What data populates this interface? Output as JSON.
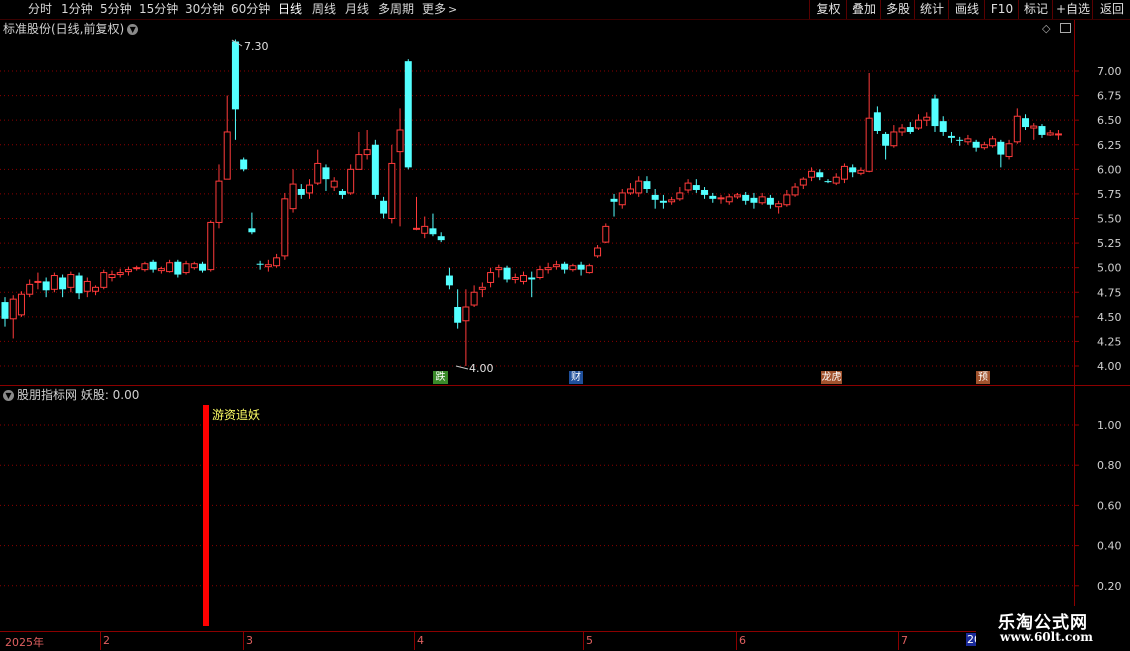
{
  "toolbar": {
    "periods": [
      "分时",
      "1分钟",
      "5分钟",
      "15分钟",
      "30分钟",
      "60分钟",
      "日线",
      "周线",
      "月线",
      "多周期",
      "更多"
    ],
    "active_period": "日线",
    "right_buttons": [
      "复权",
      "叠加",
      "多股",
      "统计",
      "画线",
      "F10",
      "标记",
      "+自选",
      "返回"
    ]
  },
  "main_panel": {
    "title": "标准股份(日线,前复权)",
    "price_axis": [
      "7.00",
      "6.75",
      "6.50",
      "6.25",
      "6.00",
      "5.75",
      "5.50",
      "5.25",
      "5.00",
      "4.75",
      "4.50",
      "4.25",
      "4.00"
    ],
    "high_label": "7.30",
    "low_label": "4.00",
    "event_badges": [
      {
        "text": "跌",
        "color": "#3a8a2a"
      },
      {
        "text": "财",
        "color": "#1f4f9a"
      },
      {
        "text": "龙虎",
        "color": "#a0522d"
      },
      {
        "text": "预",
        "color": "#a0522d"
      }
    ]
  },
  "indicator_panel": {
    "title": "股朋指标网 妖股: 0.00",
    "signal_label": "游资追妖",
    "axis": [
      "1.00",
      "0.80",
      "0.60",
      "0.40",
      "0.20"
    ]
  },
  "time_axis": [
    "2025年",
    "2",
    "3",
    "4",
    "5",
    "6",
    "7",
    "20"
  ],
  "watermark": {
    "line1": "乐淘公式网",
    "line2": "www.60lt.com"
  },
  "colors": {
    "up": "#ff3b3b",
    "down": "#54ffff",
    "grid": "#8b0000",
    "signal": "#ff0000",
    "label_yellow": "#ffff66"
  },
  "chart_data": {
    "type": "candlestick",
    "ylim": [
      3.9,
      7.25
    ],
    "candles": [
      [
        4.65,
        4.48,
        4.7,
        4.4
      ],
      [
        4.48,
        4.68,
        4.72,
        4.28
      ],
      [
        4.52,
        4.73,
        4.76,
        4.5
      ],
      [
        4.73,
        4.83,
        4.88,
        4.7
      ],
      [
        4.85,
        4.86,
        4.95,
        4.78
      ],
      [
        4.86,
        4.77,
        4.9,
        4.7
      ],
      [
        4.78,
        4.92,
        4.95,
        4.75
      ],
      [
        4.9,
        4.78,
        4.93,
        4.7
      ],
      [
        4.8,
        4.93,
        4.96,
        4.75
      ],
      [
        4.92,
        4.74,
        4.95,
        4.68
      ],
      [
        4.76,
        4.86,
        4.9,
        4.7
      ],
      [
        4.76,
        4.8,
        4.82,
        4.72
      ],
      [
        4.8,
        4.95,
        4.98,
        4.78
      ],
      [
        4.9,
        4.93,
        4.97,
        4.86
      ],
      [
        4.93,
        4.95,
        4.99,
        4.9
      ],
      [
        4.96,
        4.98,
        5.01,
        4.92
      ],
      [
        5.0,
        5.0,
        5.02,
        4.97
      ],
      [
        4.98,
        5.04,
        5.06,
        4.96
      ],
      [
        5.06,
        4.98,
        5.08,
        4.95
      ],
      [
        4.97,
        4.99,
        5.01,
        4.94
      ],
      [
        4.96,
        5.05,
        5.08,
        4.95
      ],
      [
        5.06,
        4.93,
        5.08,
        4.9
      ],
      [
        4.95,
        5.04,
        5.07,
        4.93
      ],
      [
        5.0,
        5.04,
        5.06,
        4.98
      ],
      [
        5.04,
        4.97,
        5.06,
        4.95
      ],
      [
        4.98,
        5.46,
        5.48,
        4.96
      ],
      [
        5.46,
        5.88,
        6.05,
        5.4
      ],
      [
        5.9,
        6.38,
        6.75,
        5.9
      ],
      [
        7.3,
        6.61,
        7.32,
        6.3
      ],
      [
        6.1,
        6.0,
        6.12,
        5.98
      ],
      [
        5.4,
        5.36,
        5.56,
        5.34
      ],
      [
        5.04,
        5.03,
        5.07,
        4.98
      ],
      [
        5.01,
        5.03,
        5.08,
        4.96
      ],
      [
        5.02,
        5.1,
        5.14,
        5.0
      ],
      [
        5.12,
        5.7,
        5.76,
        5.08
      ],
      [
        5.6,
        5.85,
        6.0,
        5.56
      ],
      [
        5.8,
        5.74,
        5.85,
        5.7
      ],
      [
        5.76,
        5.84,
        5.9,
        5.7
      ],
      [
        5.86,
        6.06,
        6.2,
        5.84
      ],
      [
        6.02,
        5.9,
        6.05,
        5.78
      ],
      [
        5.82,
        5.88,
        5.92,
        5.78
      ],
      [
        5.78,
        5.74,
        5.8,
        5.7
      ],
      [
        5.76,
        6.0,
        6.05,
        5.74
      ],
      [
        6.0,
        6.15,
        6.38,
        6.0
      ],
      [
        6.15,
        6.2,
        6.4,
        6.1
      ],
      [
        6.25,
        5.74,
        6.3,
        5.7
      ],
      [
        5.68,
        5.55,
        5.72,
        5.5
      ],
      [
        5.5,
        6.06,
        6.25,
        5.45
      ],
      [
        6.18,
        6.4,
        6.62,
        5.42
      ],
      [
        7.1,
        6.02,
        7.12,
        6.0
      ],
      [
        5.4,
        5.4,
        5.72,
        5.38
      ],
      [
        5.35,
        5.42,
        5.52,
        5.3
      ],
      [
        5.4,
        5.34,
        5.55,
        5.32
      ],
      [
        5.32,
        5.28,
        5.36,
        5.26
      ],
      [
        4.92,
        4.82,
        5.0,
        4.78
      ],
      [
        4.6,
        4.44,
        4.78,
        4.38
      ],
      [
        4.46,
        4.6,
        4.78,
        4.0
      ],
      [
        4.62,
        4.75,
        4.82,
        4.6
      ],
      [
        4.78,
        4.8,
        4.85,
        4.7
      ],
      [
        4.85,
        4.95,
        5.0,
        4.8
      ],
      [
        4.98,
        5.0,
        5.03,
        4.9
      ],
      [
        5.0,
        4.88,
        5.02,
        4.85
      ],
      [
        4.88,
        4.9,
        4.94,
        4.84
      ],
      [
        4.86,
        4.92,
        4.96,
        4.83
      ],
      [
        4.9,
        4.88,
        4.96,
        4.7
      ],
      [
        4.9,
        4.98,
        5.02,
        4.88
      ],
      [
        4.98,
        5.0,
        5.05,
        4.94
      ],
      [
        5.01,
        5.03,
        5.07,
        4.98
      ],
      [
        5.04,
        4.98,
        5.06,
        4.94
      ],
      [
        4.98,
        5.02,
        5.04,
        4.96
      ],
      [
        5.03,
        4.98,
        5.06,
        4.92
      ],
      [
        4.95,
        5.02,
        5.04,
        4.94
      ],
      [
        5.12,
        5.2,
        5.23,
        5.1
      ],
      [
        5.26,
        5.42,
        5.45,
        5.25
      ],
      [
        5.7,
        5.67,
        5.75,
        5.52
      ],
      [
        5.64,
        5.76,
        5.8,
        5.6
      ],
      [
        5.76,
        5.8,
        5.86,
        5.74
      ],
      [
        5.76,
        5.88,
        5.93,
        5.72
      ],
      [
        5.88,
        5.8,
        5.93,
        5.76
      ],
      [
        5.74,
        5.69,
        5.8,
        5.6
      ],
      [
        5.68,
        5.66,
        5.74,
        5.6
      ],
      [
        5.67,
        5.69,
        5.72,
        5.64
      ],
      [
        5.7,
        5.76,
        5.82,
        5.68
      ],
      [
        5.79,
        5.86,
        5.9,
        5.76
      ],
      [
        5.84,
        5.79,
        5.9,
        5.76
      ],
      [
        5.79,
        5.74,
        5.82,
        5.7
      ],
      [
        5.73,
        5.7,
        5.76,
        5.66
      ],
      [
        5.7,
        5.71,
        5.74,
        5.65
      ],
      [
        5.67,
        5.72,
        5.75,
        5.64
      ],
      [
        5.72,
        5.74,
        5.76,
        5.7
      ],
      [
        5.74,
        5.68,
        5.77,
        5.64
      ],
      [
        5.71,
        5.66,
        5.76,
        5.6
      ],
      [
        5.66,
        5.72,
        5.76,
        5.64
      ],
      [
        5.71,
        5.64,
        5.74,
        5.6
      ],
      [
        5.62,
        5.65,
        5.68,
        5.55
      ],
      [
        5.64,
        5.74,
        5.79,
        5.62
      ],
      [
        5.74,
        5.82,
        5.86,
        5.72
      ],
      [
        5.84,
        5.9,
        5.92,
        5.8
      ],
      [
        5.92,
        5.98,
        6.02,
        5.88
      ],
      [
        5.97,
        5.92,
        6.0,
        5.89
      ],
      [
        5.88,
        5.87,
        5.9,
        5.86
      ],
      [
        5.86,
        5.92,
        5.96,
        5.84
      ],
      [
        5.9,
        6.03,
        6.06,
        5.86
      ],
      [
        6.02,
        5.97,
        6.05,
        5.92
      ],
      [
        5.96,
        5.99,
        6.02,
        5.94
      ],
      [
        5.98,
        6.52,
        6.98,
        5.97
      ],
      [
        6.58,
        6.39,
        6.64,
        6.36
      ],
      [
        6.36,
        6.24,
        6.38,
        6.1
      ],
      [
        6.24,
        6.38,
        6.45,
        6.22
      ],
      [
        6.38,
        6.42,
        6.46,
        6.34
      ],
      [
        6.43,
        6.38,
        6.48,
        6.36
      ],
      [
        6.42,
        6.5,
        6.56,
        6.4
      ],
      [
        6.5,
        6.53,
        6.58,
        6.44
      ],
      [
        6.72,
        6.44,
        6.76,
        6.38
      ],
      [
        6.49,
        6.38,
        6.54,
        6.34
      ],
      [
        6.34,
        6.32,
        6.38,
        6.27
      ],
      [
        6.3,
        6.29,
        6.33,
        6.24
      ],
      [
        6.28,
        6.31,
        6.35,
        6.25
      ],
      [
        6.28,
        6.22,
        6.3,
        6.18
      ],
      [
        6.22,
        6.25,
        6.28,
        6.2
      ],
      [
        6.24,
        6.31,
        6.34,
        6.22
      ],
      [
        6.28,
        6.15,
        6.3,
        6.02
      ],
      [
        6.13,
        6.26,
        6.3,
        6.1
      ],
      [
        6.28,
        6.54,
        6.62,
        6.26
      ],
      [
        6.52,
        6.43,
        6.56,
        6.4
      ],
      [
        6.42,
        6.44,
        6.47,
        6.3
      ],
      [
        6.44,
        6.35,
        6.46,
        6.32
      ],
      [
        6.35,
        6.37,
        6.4,
        6.34
      ],
      [
        6.36,
        6.36,
        6.4,
        6.3
      ]
    ],
    "indicator": {
      "series_name": "妖股",
      "signal_values": [
        {
          "index": 25,
          "value": 1.0
        }
      ]
    }
  }
}
